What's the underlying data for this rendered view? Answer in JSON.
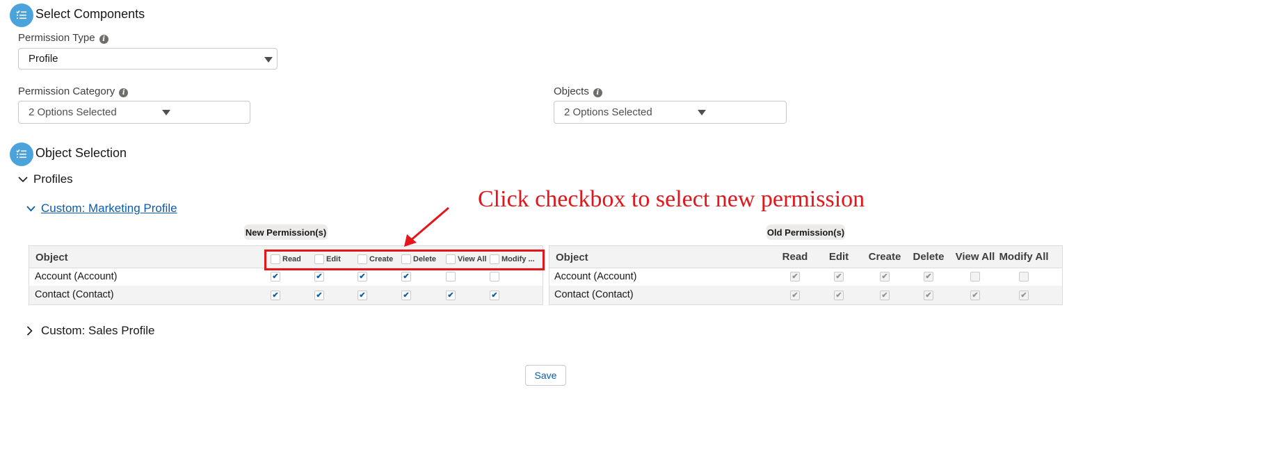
{
  "select_components": {
    "title": "Select Components",
    "permission_type": {
      "label": "Permission Type",
      "value": "Profile"
    },
    "permission_category": {
      "label": "Permission Category",
      "value": "2 Options Selected"
    },
    "objects": {
      "label": "Objects",
      "value": "2 Options Selected"
    }
  },
  "object_selection": {
    "title": "Object Selection",
    "profiles_label": "Profiles",
    "marketing_profile": "Custom: Marketing Profile",
    "sales_profile": "Custom: Sales Profile"
  },
  "new_permissions": {
    "pill": "New Permission(s)",
    "object_header": "Object",
    "headers": [
      "Read",
      "Edit",
      "Create",
      "Delete",
      "View All",
      "Modify ..."
    ],
    "rows": [
      {
        "object": "Account (Account)",
        "checks": [
          true,
          true,
          true,
          true,
          false,
          false
        ]
      },
      {
        "object": "Contact (Contact)",
        "checks": [
          true,
          true,
          true,
          true,
          true,
          true
        ]
      }
    ]
  },
  "old_permissions": {
    "pill": "Old Permission(s)",
    "object_header": "Object",
    "headers": [
      "Read",
      "Edit",
      "Create",
      "Delete",
      "View All",
      "Modify All"
    ],
    "rows": [
      {
        "object": "Account (Account)",
        "checks": [
          true,
          true,
          true,
          true,
          false,
          false
        ]
      },
      {
        "object": "Contact (Contact)",
        "checks": [
          true,
          true,
          true,
          true,
          true,
          true
        ]
      }
    ]
  },
  "annotation": {
    "text": "Click checkbox to select new permission",
    "color": "#e3161b"
  },
  "save_label": "Save",
  "colors": {
    "accent": "#0b5cab",
    "section_icon": "#4ba3dc",
    "annotation": "#e3161b"
  }
}
